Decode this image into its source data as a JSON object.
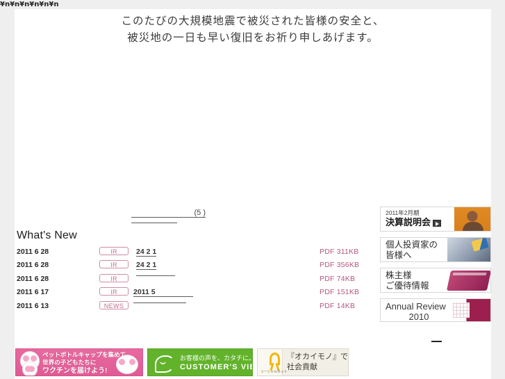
{
  "artifact_text": "¥n¥n¥n¥n¥n¥n",
  "hero": {
    "line1": "このたびの大規模地震で被災された皆様の安全と、",
    "line2": "被災地の一日も早い復旧をお祈り申しあげます。"
  },
  "top_links": [
    {
      "label": "(5 )",
      "name": "top-link-notice-1"
    },
    {
      "label": "",
      "name": "top-link-notice-2"
    }
  ],
  "whats_new": {
    "title": "What's New",
    "rows": [
      {
        "date": "2011 6 28",
        "badge": "IR",
        "title": "24 2  1",
        "pdf": "PDF 311KB"
      },
      {
        "date": "2011 6 28",
        "badge": "IR",
        "title": "24 2  1",
        "pdf": "PDF 356KB"
      },
      {
        "date": "2011 6 28",
        "badge": "IR",
        "title": "",
        "pdf": "PDF 74KB"
      },
      {
        "date": "2011 6 17",
        "badge": "IR",
        "title": "2011 5",
        "pdf": "PDF 151KB"
      },
      {
        "date": "2011 6 13",
        "badge": "NEWS",
        "title": "",
        "pdf": "PDF 14KB"
      }
    ]
  },
  "side_banners": [
    {
      "line1": "2011年2月期",
      "line2": "決算説明会",
      "has_video_icon": true
    },
    {
      "line1": "個人投資家の",
      "line2": "皆様へ",
      "has_video_icon": false
    },
    {
      "line1": "株主様",
      "line2": "ご優待情報",
      "has_video_icon": false
    },
    {
      "line1": "Annual Review",
      "line2": "2010",
      "has_video_icon": false
    }
  ],
  "side_more_link": "",
  "bottom_banners": {
    "panda": {
      "line1": "ペットボトルキャップを集めて、",
      "line2": "世界の子どもたちに",
      "line3": "ワクチンを届けよう!"
    },
    "customer": {
      "line1": "お客様の声を、カタチに。",
      "line2": "CUSTOMER'S VIEW"
    },
    "okaimono": {
      "ribbon_label": "ソーシャルネット",
      "line1": "『オカイモノ』で",
      "line2": "社会貢献"
    }
  },
  "colors": {
    "accent_pink": "#b5567f",
    "badge_border": "#cf8ba8",
    "green": "#62b32b",
    "panda_pink": "#e05b95"
  }
}
